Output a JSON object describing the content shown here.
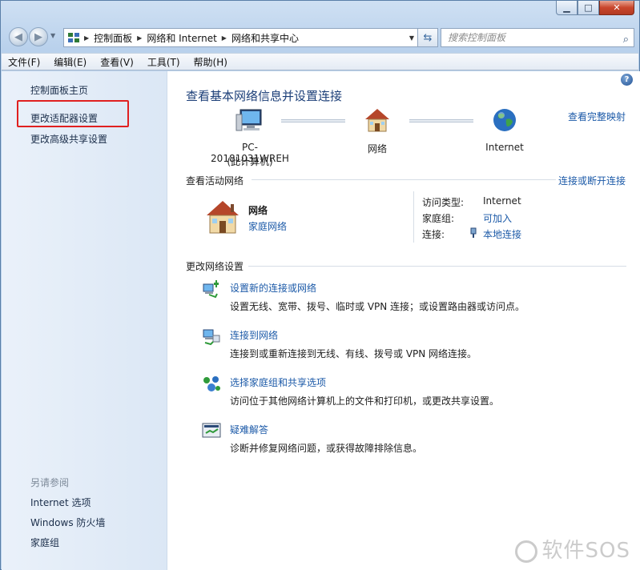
{
  "window": {
    "minimize": "▁",
    "maximize": "□",
    "close": "✕"
  },
  "address": {
    "crumbs": [
      "控制面板",
      "网络和 Internet",
      "网络和共享中心"
    ],
    "search_placeholder": "搜索控制面板"
  },
  "menu": [
    "文件(F)",
    "编辑(E)",
    "查看(V)",
    "工具(T)",
    "帮助(H)"
  ],
  "sidebar": {
    "links": [
      "控制面板主页",
      "更改适配器设置",
      "更改高级共享设置"
    ],
    "see_also_label": "另请参阅",
    "see_also": [
      "Internet 选项",
      "Windows 防火墙",
      "家庭组"
    ]
  },
  "main": {
    "help": "?",
    "title": "查看基本网络信息并设置连接",
    "full_map": "查看完整映射",
    "nodes": {
      "pc_name": "PC-20181031WREH",
      "pc_sub": "(此计算机)",
      "network": "网络",
      "internet": "Internet"
    },
    "active": {
      "header": "查看活动网络",
      "connect_link": "连接或断开连接",
      "name": "网络",
      "type": "家庭网络",
      "access_type_label": "访问类型:",
      "access_type_value": "Internet",
      "homegroup_label": "家庭组:",
      "homegroup_value": "可加入",
      "connection_label": "连接:",
      "connection_value": "本地连接"
    },
    "change_header": "更改网络设置",
    "tasks": [
      {
        "title": "设置新的连接或网络",
        "desc": "设置无线、宽带、拨号、临时或 VPN 连接；或设置路由器或访问点。"
      },
      {
        "title": "连接到网络",
        "desc": "连接到或重新连接到无线、有线、拨号或 VPN 网络连接。"
      },
      {
        "title": "选择家庭组和共享选项",
        "desc": "访问位于其他网络计算机上的文件和打印机，或更改共享设置。"
      },
      {
        "title": "疑难解答",
        "desc": "诊断并修复网络问题，或获得故障排除信息。"
      }
    ]
  },
  "watermark": "软件SOS"
}
